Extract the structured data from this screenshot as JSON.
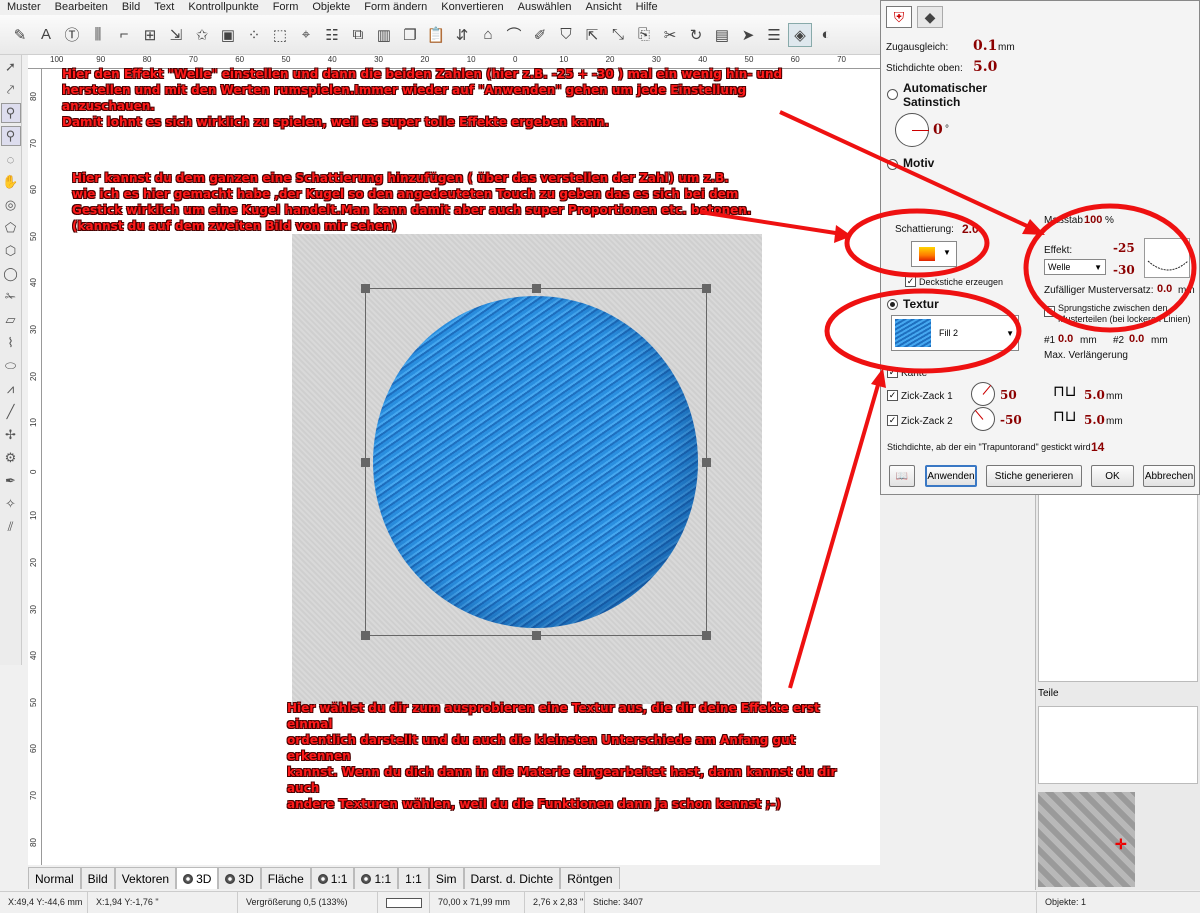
{
  "menu": [
    "Muster",
    "Bearbeiten",
    "Bild",
    "Text",
    "Kontrollpunkte",
    "Form",
    "Objekte",
    "Form ändern",
    "Konvertieren",
    "Auswählen",
    "Ansicht",
    "Hilfe"
  ],
  "ruler": {
    "h_labels": [
      "100",
      "90",
      "80",
      "70",
      "60",
      "50",
      "40",
      "30",
      "20",
      "10",
      "0",
      "10",
      "20",
      "30",
      "40",
      "50",
      "60",
      "70",
      "80"
    ],
    "v_labels": [
      "80",
      "70",
      "60",
      "50",
      "40",
      "30",
      "20",
      "10",
      "0",
      "10",
      "20",
      "30",
      "40",
      "50",
      "60",
      "70",
      "80"
    ]
  },
  "annotations": {
    "top": "Hier den Effekt \"Welle\" einstellen und dann die beiden Zahlen (hier z.B. -25 + -30 ) mal ein wenig hin- und\nherstellen und mit den Werten rumspielen.Immer wieder auf \"Anwenden\" gehen um jede Einstellung anzuschauen.\nDamit lohnt es sich wirklich zu spielen, weil es super tolle Effekte ergeben kann.",
    "middle": "Hier kannst du dem ganzen eine Schattierung hinzufügen ( über das verstellen der Zahl) um z.B.\nwie ich es hier gemacht habe ,der Kugel so den angedeuteten Touch zu geben das es sich bei dem\nGestick wirklich um eine Kugel handelt.Man kann damit aber auch super Proportionen etc. betonen.\n(kannst du auf dem zweiten Bild von mir sehen)",
    "bottom": "Hier wählst du dir zum ausprobieren eine Textur aus, die dir deine Effekte erst einmal\nordentlich darstellt und du auch die kleinsten Unterschiede am Anfang gut erkennen\nkannst. Wenn du dich dann in die Materie eingearbeitet hast, dann kannst du dir  auch\nandere Texturen wählen, weil du die Funktionen dann ja schon kennst ;-)"
  },
  "view_tabs": [
    {
      "label": "Normal",
      "icon": false,
      "active": false
    },
    {
      "label": "Bild",
      "icon": false,
      "active": false
    },
    {
      "label": "Vektoren",
      "icon": false,
      "active": false
    },
    {
      "label": "3D",
      "icon": true,
      "active": true
    },
    {
      "label": "3D",
      "icon": true,
      "active": false
    },
    {
      "label": "Fläche",
      "icon": false,
      "active": false
    },
    {
      "label": "1:1",
      "icon": true,
      "active": false
    },
    {
      "label": "1:1",
      "icon": true,
      "active": false
    },
    {
      "label": "1:1",
      "icon": false,
      "active": false
    },
    {
      "label": "Sim",
      "icon": false,
      "active": false
    },
    {
      "label": "Darst. d. Dichte",
      "icon": false,
      "active": false
    },
    {
      "label": "Röntgen",
      "icon": false,
      "active": false
    }
  ],
  "status": {
    "coords_mm": "X:49,4  Y:-44,6 mm",
    "coords_in": "X:1,94  Y:-1,76 \"",
    "zoom": "Vergrößerung 0,5 (133%)",
    "size_mm": "70,00 x 71,99 mm",
    "size_in": "2,76 x 2,83 \"",
    "stitches": "Stiche: 3407",
    "objects": "Objekte: 1"
  },
  "dock": {
    "teile_label": "Teile"
  },
  "dialog": {
    "zugausgleich_label": "Zugausgleich:",
    "zugausgleich_value": "0.1",
    "zugausgleich_unit": "mm",
    "stichdichte_oben_label": "Stichdichte oben:",
    "stichdichte_oben_value": "5.0",
    "auto_satin_label": "Automatischer Satinstich",
    "angle_value": "0",
    "angle_unit": "°",
    "motiv_label": "Motiv",
    "massstab_label": "Maßstab",
    "massstab_value": "100",
    "massstab_unit": "%",
    "effekt_label": "Effekt:",
    "effekt_value": "Welle",
    "effekt_num1": "-25",
    "effekt_num2": "-30",
    "zufall_label": "Zufälliger Musterversatz:",
    "zufall_value": "0.0",
    "zufall_unit": "mm",
    "sprung_label": "Sprungstiche zwischen den Musterteilen (bei lockeren Linien)",
    "p1_label": "#1",
    "p1_value": "0.0",
    "p1_unit": "mm",
    "p2_label": "#2",
    "p2_value": "0.0",
    "p2_unit": "mm",
    "max_verl_label": "Max. Verlängerung",
    "schattierung_label": "Schattierung:",
    "schattierung_value": "2.0",
    "deckstiche_label": "Deckstiche erzeugen",
    "textur_label": "Textur",
    "textur_value": "Fill 2",
    "kante_label": "Kante",
    "zz1_label": "Zick-Zack 1",
    "zz1_angle": "50",
    "zz1_len": "5.0",
    "zz1_unit": "mm",
    "zz2_label": "Zick-Zack 2",
    "zz2_angle": "-50",
    "zz2_len": "5.0",
    "zz2_unit": "mm",
    "trapunto_label": "Stichdichte, ab der ein \"Trapuntorand\" gestickt wird",
    "trapunto_value": "14",
    "btn_apply": "Anwenden",
    "btn_generate": "Stiche generieren",
    "btn_ok": "OK",
    "btn_cancel": "Abbrechen"
  },
  "colors": {
    "annotation": "#ff1a1a",
    "value": "#8b0000",
    "ball": "#2a8fe0",
    "callout": "#ee1111"
  }
}
